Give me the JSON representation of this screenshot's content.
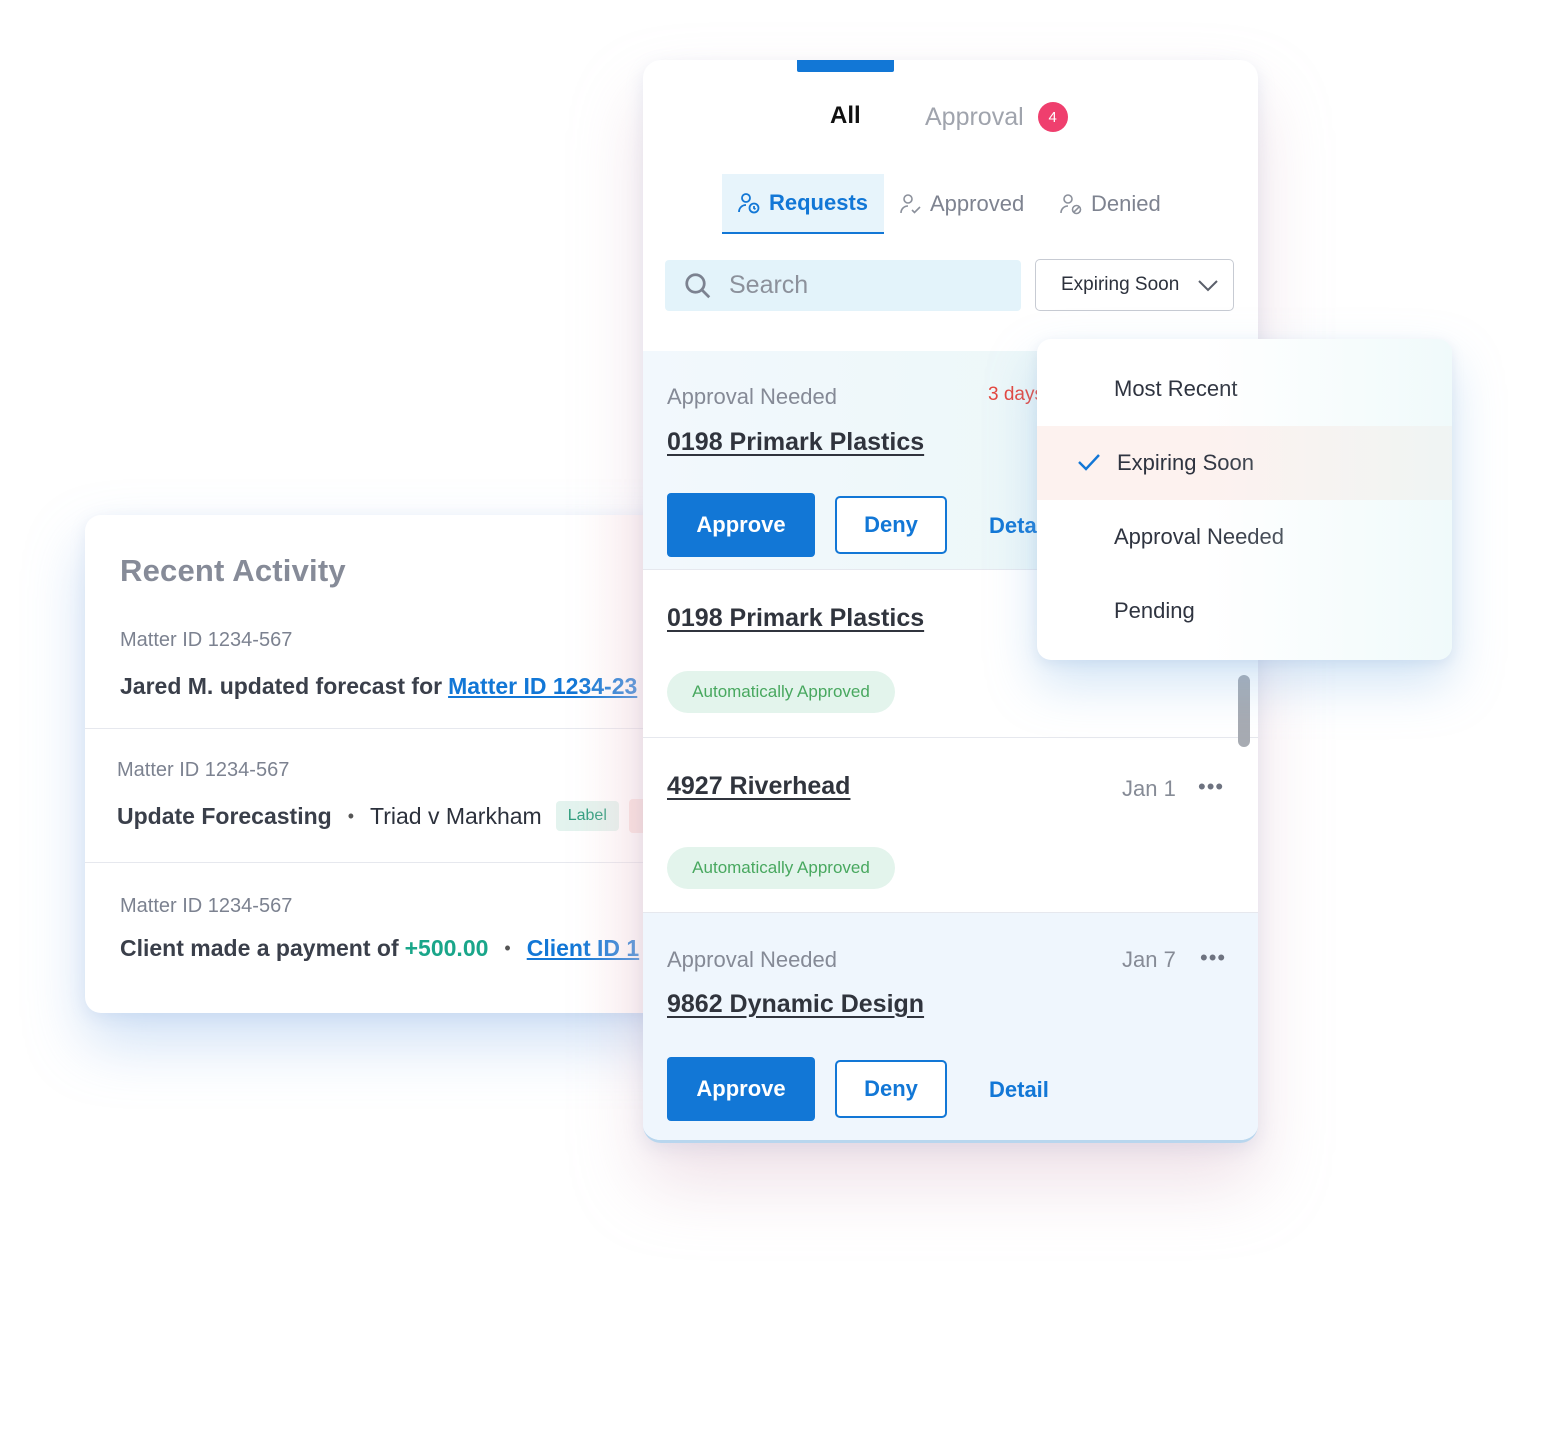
{
  "activity": {
    "title": "Recent Activity",
    "rows": [
      {
        "meta": "Matter ID 1234-567",
        "text": "Jared M. updated forecast for ",
        "link": "Matter ID 1234-23"
      },
      {
        "meta": "Matter ID 1234-567",
        "title": "Update Forecasting",
        "separator": "•",
        "case": "Triad v Markham",
        "chip": "Label"
      },
      {
        "meta": "Matter ID 1234-567",
        "text": "Client made a payment of ",
        "amount": "+500.00",
        "separator": "•",
        "link": "Client ID 1"
      }
    ]
  },
  "panel": {
    "tabs": {
      "all": "All",
      "approval": "Approval",
      "approval_count": "4"
    },
    "subtabs": {
      "requests": "Requests",
      "approved": "Approved",
      "denied": "Denied"
    },
    "search": {
      "placeholder": "Search"
    },
    "sort": {
      "selected": "Expiring Soon"
    },
    "items": [
      {
        "status": "Approval Needed",
        "due": "3 days",
        "title": "0198 Primark Plastics",
        "approve": "Approve",
        "deny": "Deny",
        "detail": "Detail"
      },
      {
        "title": "0198 Primark Plastics",
        "badge": "Automatically Approved"
      },
      {
        "title": "4927 Riverhead",
        "date": "Jan 1",
        "more": "•••",
        "badge": "Automatically Approved"
      },
      {
        "status": "Approval Needed",
        "date": "Jan 7",
        "more": "•••",
        "title": "9862 Dynamic Design",
        "approve": "Approve",
        "deny": "Deny",
        "detail": "Detail"
      }
    ]
  },
  "dropdown": {
    "options": [
      "Most Recent",
      "Expiring Soon",
      "Approval Needed",
      "Pending"
    ],
    "selected": "Expiring Soon"
  },
  "colors": {
    "accent": "#1277d6",
    "badge": "#ef3f6e",
    "positive": "#1aa68a",
    "due": "#e4463e",
    "auto_approved": "#48a85f"
  }
}
